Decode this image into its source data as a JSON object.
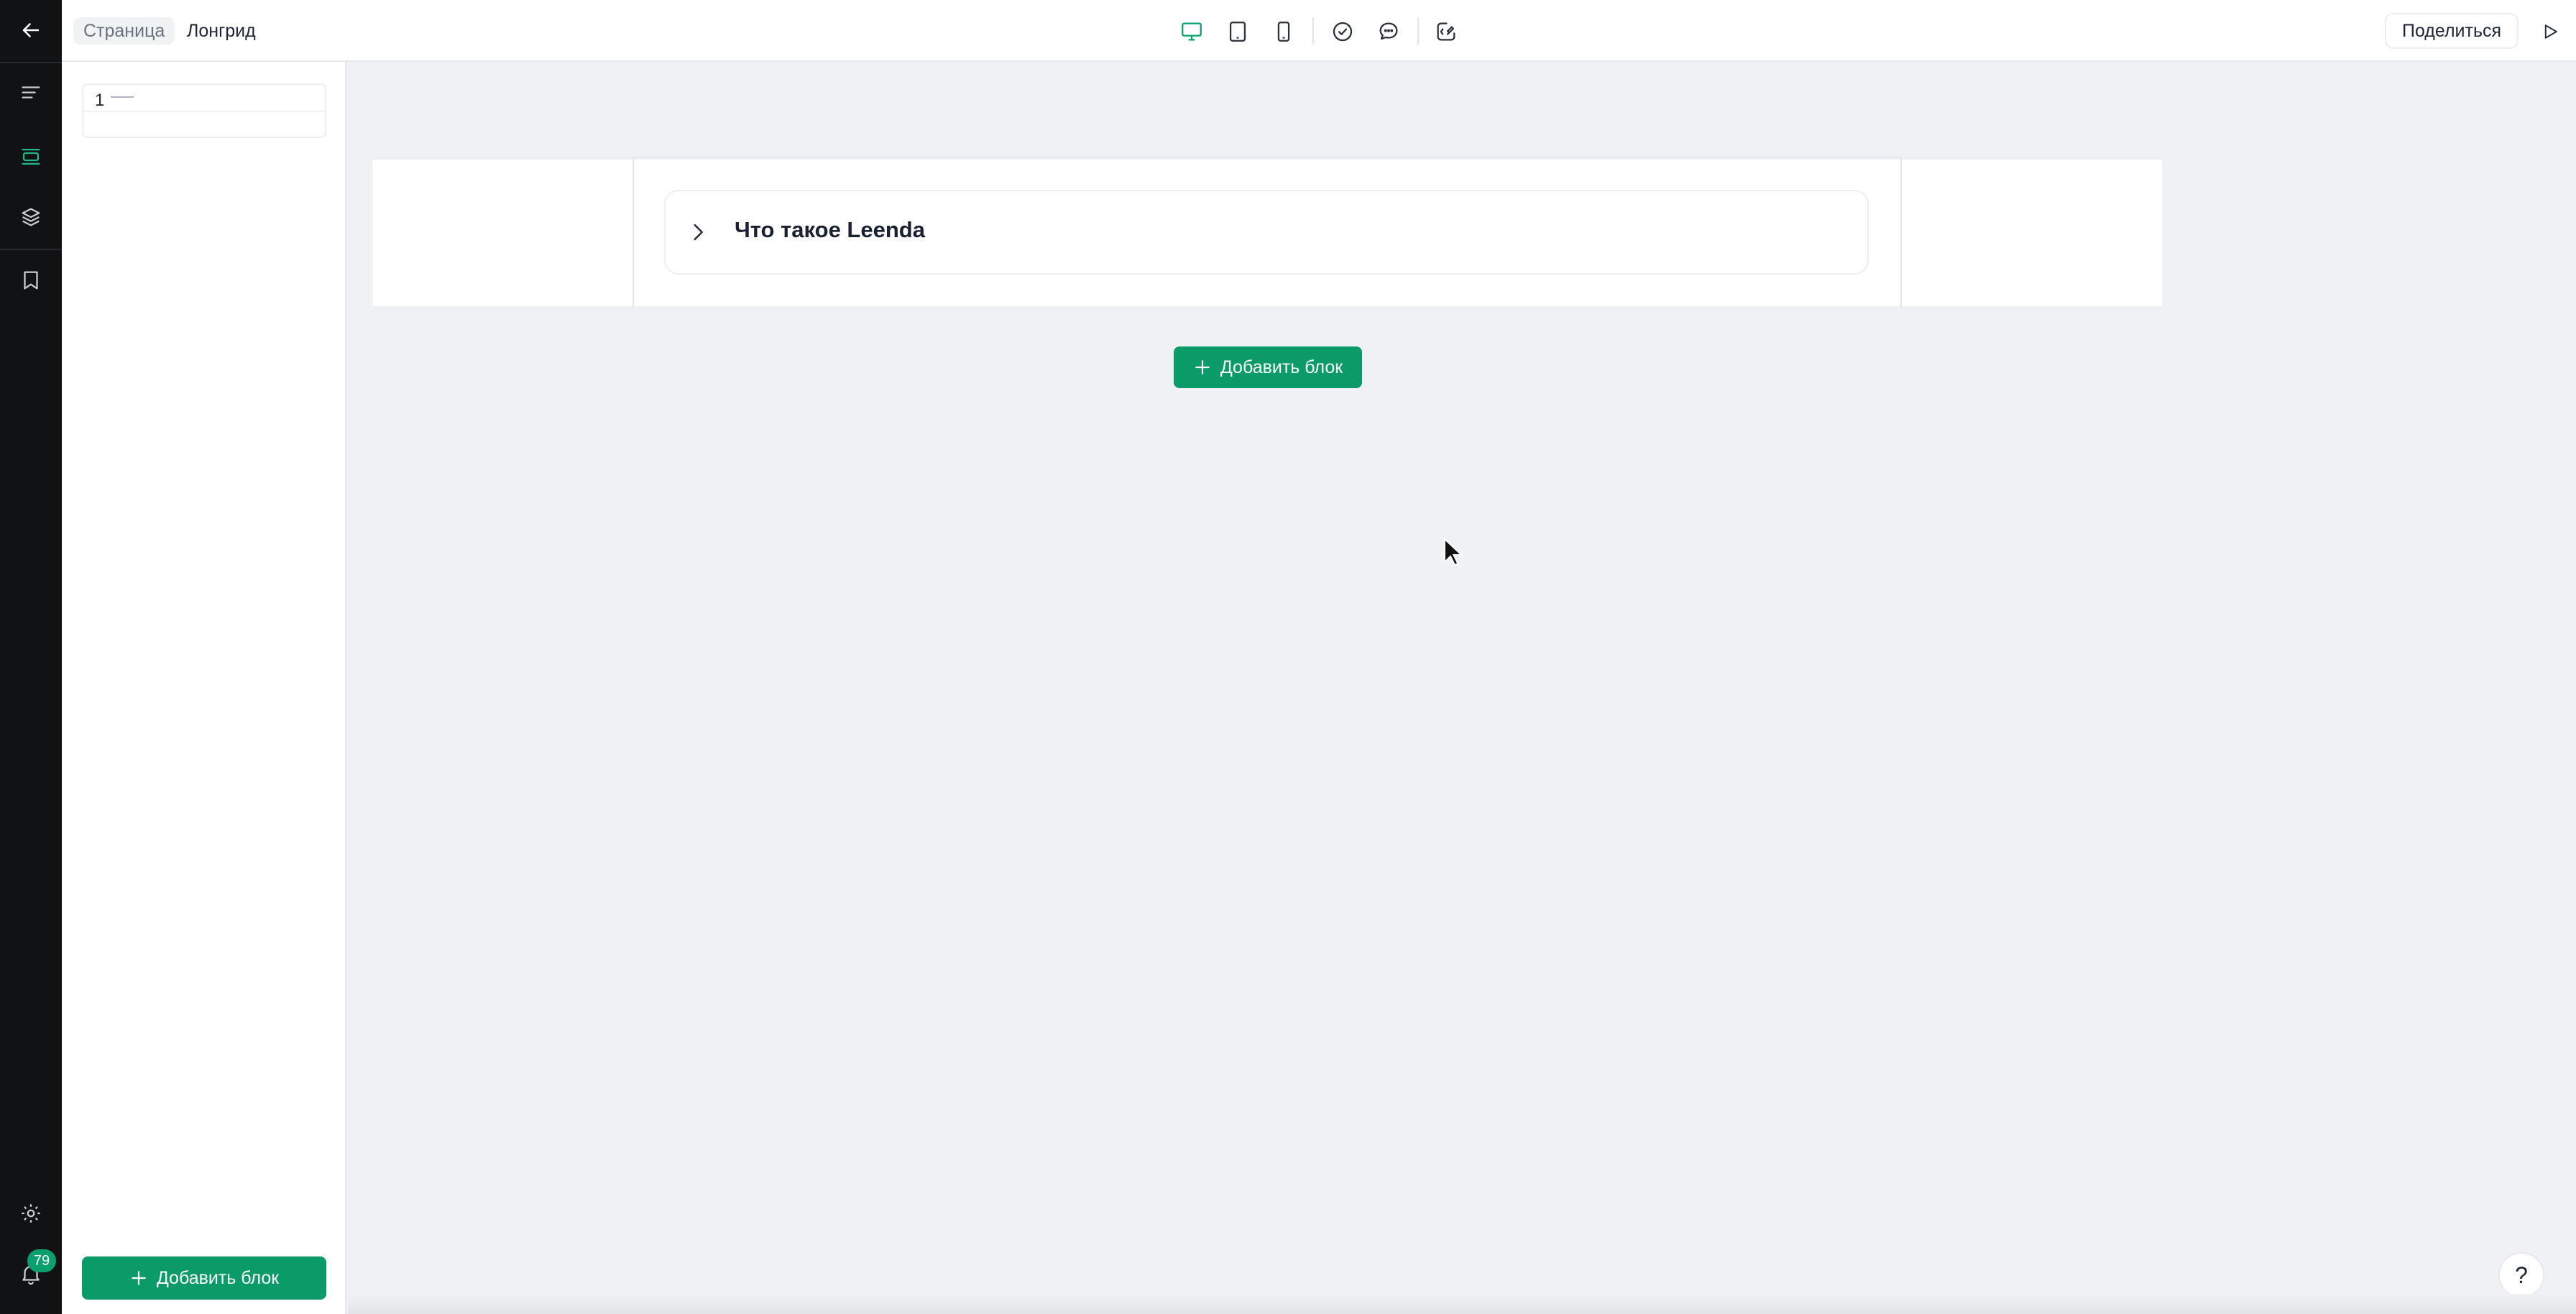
{
  "header": {
    "breadcrumb_page": "Страница",
    "breadcrumb_current": "Лонгрид",
    "share_label": "Поделиться",
    "toolbar_icons": [
      "desktop-icon",
      "tablet-icon",
      "mobile-icon",
      "check-circle-icon",
      "comment-icon",
      "ai-edit-icon"
    ],
    "active_device": "desktop",
    "accent_color": "#0aa06e"
  },
  "rail": {
    "icons": [
      "back-arrow-icon",
      "menu-icon",
      "blocks-icon",
      "layers-icon",
      "bookmark-icon",
      "settings-icon",
      "bell-icon"
    ],
    "notification_count": "79"
  },
  "panel": {
    "items": [
      {
        "number": "1",
        "title": "——"
      }
    ],
    "add_block_label": "Добавить блок"
  },
  "canvas": {
    "accordion_title": "Что такое Leenda",
    "add_block_label": "Добавить блок"
  },
  "help_label": "?"
}
